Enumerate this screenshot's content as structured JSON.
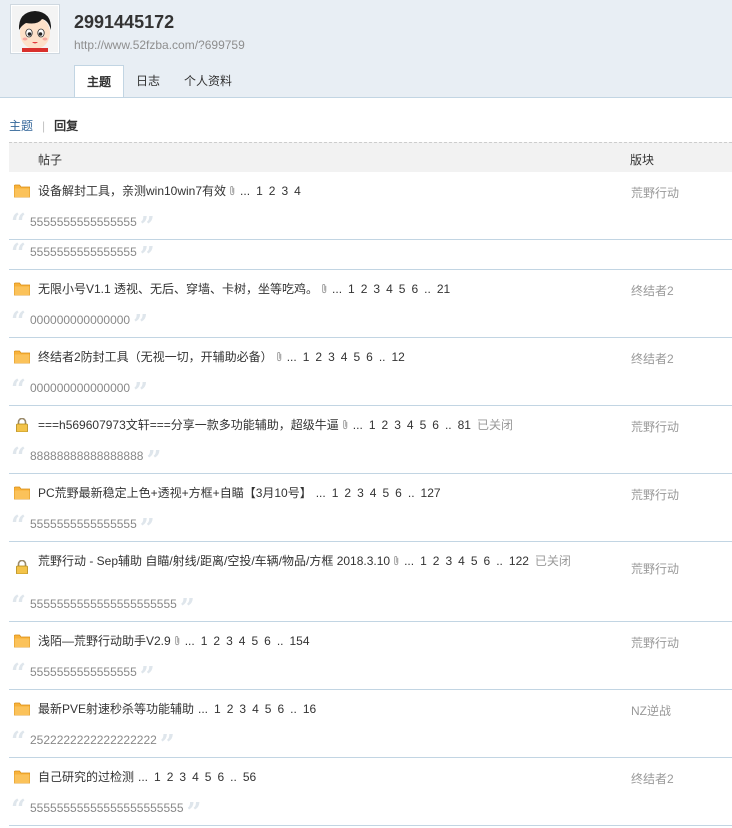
{
  "profile": {
    "username": "2991445172",
    "url": "http://www.52fzba.com/?699759"
  },
  "tabs": [
    {
      "label": "主题",
      "active": true
    },
    {
      "label": "日志",
      "active": false
    },
    {
      "label": "个人资料",
      "active": false
    }
  ],
  "sub_tabs": [
    {
      "label": "主题",
      "current": false
    },
    {
      "label": "回复",
      "current": true
    }
  ],
  "table": {
    "col_post": "帖子",
    "col_forum": "版块"
  },
  "rows": [
    {
      "icon": "folder-icon",
      "title": "设备解封工具，亲测win10win7有效",
      "attachment": true,
      "pages": [
        "1",
        "2",
        "3",
        "4"
      ],
      "closed": "",
      "forum": "荒野行动",
      "quotes": [
        "5555555555555555",
        "5555555555555555"
      ],
      "tall": false
    },
    {
      "icon": "folder-icon",
      "title": "无限小号V1.1 透视、无后、穿墙、卡树，坐等吃鸡。",
      "attachment": true,
      "pages": [
        "1",
        "2",
        "3",
        "4",
        "5",
        "6",
        "..",
        "21"
      ],
      "closed": "",
      "forum": "终结者2",
      "quotes": [
        "000000000000000"
      ],
      "tall": false
    },
    {
      "icon": "folder-icon",
      "title": "终结者2防封工具（无视一切，开辅助必备）",
      "attachment": true,
      "pages": [
        "1",
        "2",
        "3",
        "4",
        "5",
        "6",
        "..",
        "12"
      ],
      "closed": "",
      "forum": "终结者2",
      "quotes": [
        "000000000000000"
      ],
      "tall": false
    },
    {
      "icon": "lock-icon",
      "title": "===h569607973文轩===分享一款多功能辅助，超级牛逼",
      "attachment": true,
      "pages": [
        "1",
        "2",
        "3",
        "4",
        "5",
        "6",
        "..",
        "81"
      ],
      "closed": "已关闭",
      "forum": "荒野行动",
      "quotes": [
        "88888888888888888"
      ],
      "tall": false
    },
    {
      "icon": "folder-icon",
      "title": "PC荒野最新稳定上色+透视+方框+自瞄【3月10号】",
      "attachment": false,
      "pages": [
        "1",
        "2",
        "3",
        "4",
        "5",
        "6",
        "..",
        "127"
      ],
      "closed": "",
      "forum": "荒野行动",
      "quotes": [
        "5555555555555555"
      ],
      "tall": false
    },
    {
      "icon": "lock-icon",
      "title": "荒野行动 - Sep辅助 自瞄/射线/距离/空投/车辆/物品/方框 2018.3.10",
      "attachment": true,
      "pages": [
        "1",
        "2",
        "3",
        "4",
        "5",
        "6",
        "..",
        "122"
      ],
      "closed": "已关闭",
      "forum": "荒野行动",
      "quotes": [
        "5555555555555555555555"
      ],
      "tall": true
    },
    {
      "icon": "folder-icon",
      "title": "浅陌—荒野行动助手V2.9",
      "attachment": true,
      "pages": [
        "1",
        "2",
        "3",
        "4",
        "5",
        "6",
        "..",
        "154"
      ],
      "closed": "",
      "forum": "荒野行动",
      "quotes": [
        "5555555555555555"
      ],
      "tall": false
    },
    {
      "icon": "folder-icon",
      "title": "最新PVE射速秒杀等功能辅助",
      "attachment": false,
      "pages": [
        "1",
        "2",
        "3",
        "4",
        "5",
        "6",
        "..",
        "16"
      ],
      "closed": "",
      "forum": "NZ逆战",
      "quotes": [
        "2522222222222222222"
      ],
      "tall": false
    },
    {
      "icon": "folder-icon",
      "title": "自己研究的过检测",
      "attachment": false,
      "pages": [
        "1",
        "2",
        "3",
        "4",
        "5",
        "6",
        "..",
        "56"
      ],
      "closed": "",
      "forum": "终结者2",
      "quotes": [
        "55555555555555555555555"
      ],
      "tall": false
    }
  ],
  "colors": {
    "header_bg": "#e8eef4",
    "border": "#c2d5e3",
    "link": "#336699",
    "folder": "#f8b23a"
  }
}
